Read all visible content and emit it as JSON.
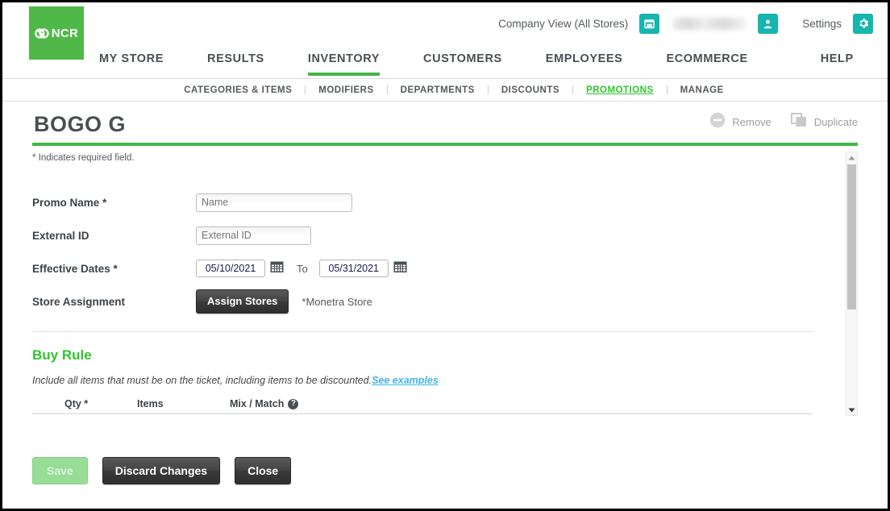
{
  "brand": {
    "logo_text": "NCR",
    "green": "#4fb848",
    "teal": "#16b5ae",
    "accent_green": "#2ec62e",
    "link_blue": "#3fb4e8"
  },
  "header": {
    "company_view_label": "Company View (All Stores)",
    "store_icon": "store-icon",
    "user_name_redacted": "",
    "user_icon": "user-icon",
    "settings_label": "Settings",
    "settings_icon": "gear-icon"
  },
  "main_nav": {
    "items": [
      {
        "label": "MY STORE",
        "active": false
      },
      {
        "label": "RESULTS",
        "active": false
      },
      {
        "label": "INVENTORY",
        "active": true
      },
      {
        "label": "CUSTOMERS",
        "active": false
      },
      {
        "label": "EMPLOYEES",
        "active": false
      },
      {
        "label": "ECOMMERCE",
        "active": false
      },
      {
        "label": "HELP",
        "active": false
      }
    ]
  },
  "sub_nav": {
    "items": [
      {
        "label": "CATEGORIES & ITEMS",
        "active": false
      },
      {
        "label": "MODIFIERS",
        "active": false
      },
      {
        "label": "DEPARTMENTS",
        "active": false
      },
      {
        "label": "DISCOUNTS",
        "active": false
      },
      {
        "label": "PROMOTIONS",
        "active": true
      },
      {
        "label": "MANAGE",
        "active": false
      }
    ]
  },
  "page": {
    "title": "BOGO G",
    "remove_label": "Remove",
    "remove_icon": "minus-circle-icon",
    "duplicate_label": "Duplicate",
    "duplicate_icon": "copy-icon"
  },
  "form": {
    "required_note": "* Indicates required field.",
    "promo_name": {
      "label": "Promo Name *",
      "value": "",
      "placeholder": "Name"
    },
    "external_id": {
      "label": "External ID",
      "value": "",
      "placeholder": "External ID"
    },
    "effective_dates": {
      "label": "Effective Dates *",
      "start_value": "05/10/2021",
      "to_word": "To",
      "end_value": "05/31/2021",
      "calendar_icon": "calendar-icon"
    },
    "store_assignment": {
      "label": "Store Assignment",
      "button_label": "Assign Stores",
      "assigned_note": "*Monetra Store"
    }
  },
  "buy_rule": {
    "title": "Buy Rule",
    "description": "Include all items that must be on the ticket, including items to be discounted.",
    "examples_link": "See examples",
    "columns": [
      {
        "label": "Qty *",
        "help": false
      },
      {
        "label": "Items",
        "help": false
      },
      {
        "label": "Mix / Match",
        "help": true,
        "help_icon": "question-mark-icon"
      }
    ]
  },
  "scrollbar": {
    "up_icon": "caret-up-icon",
    "down_icon": "caret-down-icon"
  },
  "footer": {
    "save_label": "Save",
    "discard_label": "Discard Changes",
    "close_label": "Close"
  }
}
